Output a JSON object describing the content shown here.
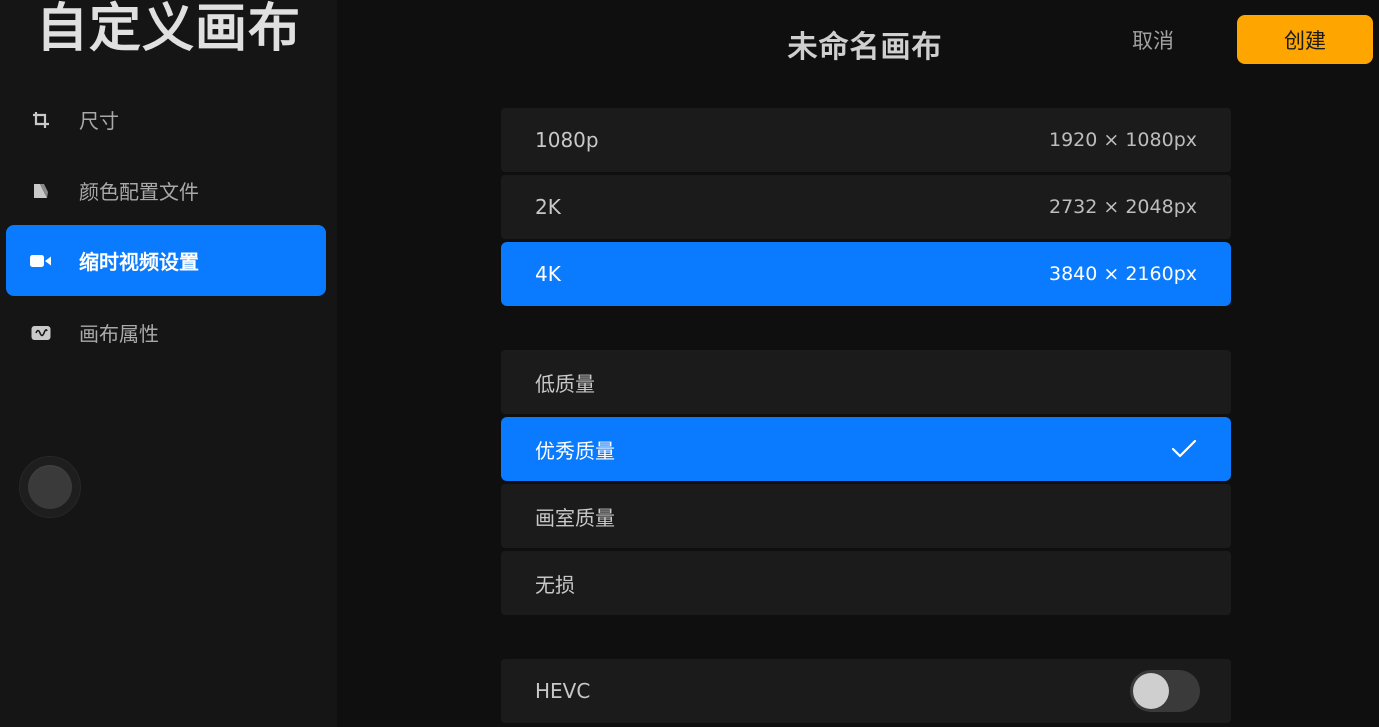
{
  "sidebar": {
    "title": "自定义画布",
    "items": [
      {
        "label": "尺寸",
        "icon": "crop-icon",
        "active": false
      },
      {
        "label": "颜色配置文件",
        "icon": "color-profile-icon",
        "active": false
      },
      {
        "label": "缩时视频设置",
        "icon": "video-camera-icon",
        "active": true
      },
      {
        "label": "画布属性",
        "icon": "canvas-properties-icon",
        "active": false
      }
    ]
  },
  "header": {
    "title": "未命名画布",
    "cancel_label": "取消",
    "create_label": "创建"
  },
  "resolutions": [
    {
      "label": "1080p",
      "value": "1920 × 1080px",
      "selected": false
    },
    {
      "label": "2K",
      "value": "2732 × 2048px",
      "selected": false
    },
    {
      "label": "4K",
      "value": "3840 × 2160px",
      "selected": true
    }
  ],
  "qualities": [
    {
      "label": "低质量",
      "selected": false
    },
    {
      "label": "优秀质量",
      "selected": true
    },
    {
      "label": "画室质量",
      "selected": false
    },
    {
      "label": "无损",
      "selected": false
    }
  ],
  "hevc": {
    "label": "HEVC",
    "enabled": false
  },
  "colors": {
    "accent": "#0a7aff",
    "create": "#ffa500"
  }
}
